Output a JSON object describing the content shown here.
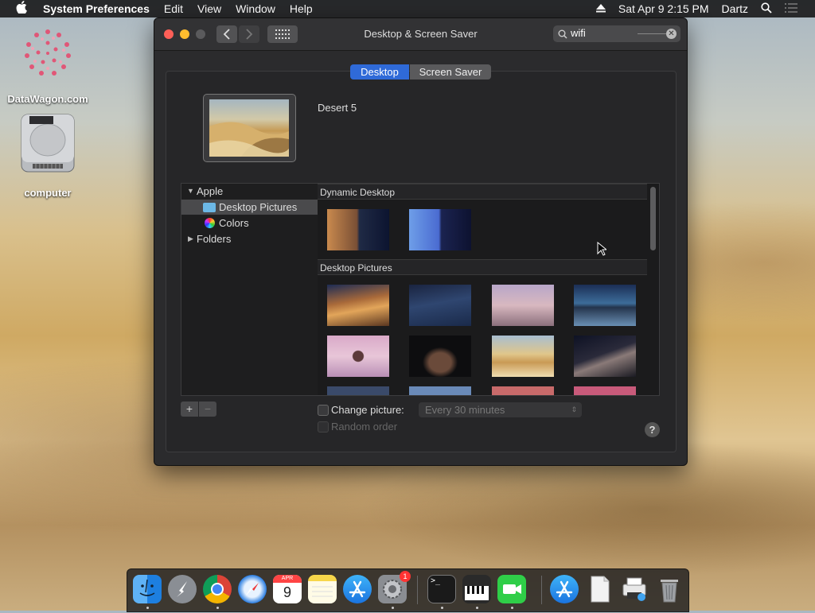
{
  "menubar": {
    "app_name": "System Preferences",
    "items": [
      "Edit",
      "View",
      "Window",
      "Help"
    ],
    "datetime": "Sat Apr 9  2:15 PM",
    "user": "Dartz"
  },
  "desktop_icons": [
    {
      "label": "DataWagon.com"
    },
    {
      "label": "computer"
    }
  ],
  "window": {
    "title": "Desktop & Screen Saver",
    "search_value": "wifi",
    "tabs": [
      {
        "label": "Desktop",
        "selected": true
      },
      {
        "label": "Screen Saver",
        "selected": false
      }
    ],
    "current_picture_name": "Desert 5",
    "sidebar": {
      "apple_label": "Apple",
      "items": [
        "Desktop Pictures",
        "Colors"
      ],
      "folders_label": "Folders"
    },
    "sections": [
      "Dynamic Desktop",
      "Desktop Pictures"
    ],
    "add_label": "+",
    "remove_label": "−",
    "change_picture_label": "Change picture:",
    "change_picture_interval": "Every 30 minutes",
    "random_order_label": "Random order",
    "help_label": "?"
  },
  "dock": {
    "apps": [
      "Finder",
      "Launchpad",
      "Chrome",
      "Safari",
      "Calendar",
      "Notes",
      "App Store",
      "System Preferences",
      "Terminal",
      "Piano",
      "FaceTime",
      "App Store",
      "Document",
      "Printer",
      "Trash"
    ],
    "calendar_month": "APR",
    "calendar_day": "9",
    "sysprefs_badge": "1"
  },
  "colors": {
    "accent": "#2f6ad8",
    "close": "#fe5f57",
    "minimize": "#febc2e",
    "zoom": "#5a5a5c"
  }
}
